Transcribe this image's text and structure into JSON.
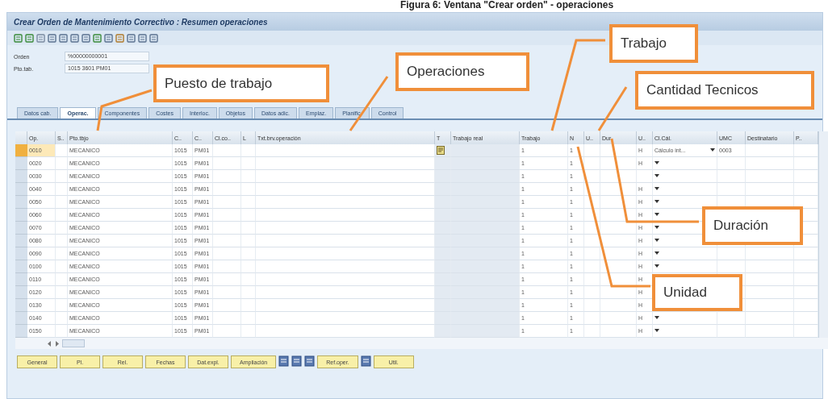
{
  "caption": "Figura 6: Ventana \"Crear orden\" - operaciones",
  "window": {
    "title": "Crear Orden de Mantenimiento Correctivo : Resumen operaciones"
  },
  "header_fields": [
    {
      "label": "Orden",
      "value": "%00000000001"
    },
    {
      "label": "Pto.tab.",
      "value": "1015 3601 PM01"
    }
  ],
  "tabs": [
    {
      "label": "Datos cab.",
      "selected": false
    },
    {
      "label": "Operac.",
      "selected": true
    },
    {
      "label": "Componentes",
      "selected": false
    },
    {
      "label": "Costes",
      "selected": false
    },
    {
      "label": "Interloc.",
      "selected": false
    },
    {
      "label": "Objetos",
      "selected": false
    },
    {
      "label": "Datos adic.",
      "selected": false
    },
    {
      "label": "Emplaz.",
      "selected": false
    },
    {
      "label": "Planific.",
      "selected": false
    },
    {
      "label": "Control",
      "selected": false
    }
  ],
  "table": {
    "columns": [
      "Op.",
      "S..",
      "Pto.tbjo",
      "C..",
      "C..",
      "Cl.co..",
      "L",
      "Txt.brv.operación",
      "T",
      "Trabajo real",
      "Trabajo",
      "N",
      "U..",
      "Dur.",
      "U..",
      "Cl.Cál.",
      "UMC",
      "Destinatario",
      "P.."
    ],
    "rows": [
      {
        "op": "0010",
        "work_center": "MECANICO",
        "plant": "1015",
        "control_key": "PM01",
        "work": "1",
        "number": "1",
        "unit": "H",
        "calc_key": "Cálculo int...",
        "umc": "0003",
        "long_text": true,
        "selected": true
      },
      {
        "op": "0020",
        "work_center": "MECANICO",
        "plant": "1015",
        "control_key": "PM01",
        "work": "1",
        "number": "1",
        "unit": "H",
        "long_text": false,
        "selected": false
      },
      {
        "op": "0030",
        "work_center": "MECANICO",
        "plant": "1015",
        "control_key": "PM01",
        "work": "1",
        "number": "1",
        "long_text": false,
        "selected": false
      },
      {
        "op": "0040",
        "work_center": "MECANICO",
        "plant": "1015",
        "control_key": "PM01",
        "work": "1",
        "number": "1",
        "unit": "H",
        "long_text": false,
        "selected": false
      },
      {
        "op": "0050",
        "work_center": "MECANICO",
        "plant": "1015",
        "control_key": "PM01",
        "work": "1",
        "number": "1",
        "unit": "H",
        "long_text": false,
        "selected": false
      },
      {
        "op": "0060",
        "work_center": "MECANICO",
        "plant": "1015",
        "control_key": "PM01",
        "work": "1",
        "number": "1",
        "unit": "H",
        "long_text": false,
        "selected": false
      },
      {
        "op": "0070",
        "work_center": "MECANICO",
        "plant": "1015",
        "control_key": "PM01",
        "work": "1",
        "number": "1",
        "unit": "H",
        "long_text": false,
        "selected": false
      },
      {
        "op": "0080",
        "work_center": "MECANICO",
        "plant": "1015",
        "control_key": "PM01",
        "work": "1",
        "number": "1",
        "unit": "H",
        "long_text": false,
        "selected": false
      },
      {
        "op": "0090",
        "work_center": "MECANICO",
        "plant": "1015",
        "control_key": "PM01",
        "work": "1",
        "number": "1",
        "unit": "H",
        "long_text": false,
        "selected": false
      },
      {
        "op": "0100",
        "work_center": "MECANICO",
        "plant": "1015",
        "control_key": "PM01",
        "work": "1",
        "number": "1",
        "unit": "H",
        "long_text": false,
        "selected": false
      },
      {
        "op": "0110",
        "work_center": "MECANICO",
        "plant": "1015",
        "control_key": "PM01",
        "work": "1",
        "number": "1",
        "unit": "H",
        "long_text": false,
        "selected": false
      },
      {
        "op": "0120",
        "work_center": "MECANICO",
        "plant": "1015",
        "control_key": "PM01",
        "work": "1",
        "number": "1",
        "unit": "H",
        "long_text": false,
        "selected": false
      },
      {
        "op": "0130",
        "work_center": "MECANICO",
        "plant": "1015",
        "control_key": "PM01",
        "work": "1",
        "number": "1",
        "unit": "H",
        "long_text": false,
        "selected": false
      },
      {
        "op": "0140",
        "work_center": "MECANICO",
        "plant": "1015",
        "control_key": "PM01",
        "work": "1",
        "number": "1",
        "unit": "H",
        "long_text": false,
        "selected": false
      },
      {
        "op": "0150",
        "work_center": "MECANICO",
        "plant": "1015",
        "control_key": "PM01",
        "work": "1",
        "number": "1",
        "unit": "H",
        "long_text": false,
        "selected": false
      }
    ]
  },
  "buttons": [
    {
      "kind": "text",
      "label": "General"
    },
    {
      "kind": "text",
      "label": "Pl."
    },
    {
      "kind": "text",
      "label": "Rel."
    },
    {
      "kind": "text",
      "label": "Fechas"
    },
    {
      "kind": "text",
      "label": "Dat.expl."
    },
    {
      "kind": "text",
      "label": "Ampliación"
    },
    {
      "kind": "icon"
    },
    {
      "kind": "icon"
    },
    {
      "kind": "icon"
    },
    {
      "kind": "text",
      "label": "Ref.oper."
    },
    {
      "kind": "icon"
    },
    {
      "kind": "text",
      "label": "Util."
    }
  ],
  "callouts": [
    {
      "label": "Puesto de trabajo"
    },
    {
      "label": "Operaciones"
    },
    {
      "label": "Trabajo"
    },
    {
      "label": "Cantidad Tecnicos"
    },
    {
      "label": "Duración"
    },
    {
      "label": "Unidad"
    }
  ]
}
